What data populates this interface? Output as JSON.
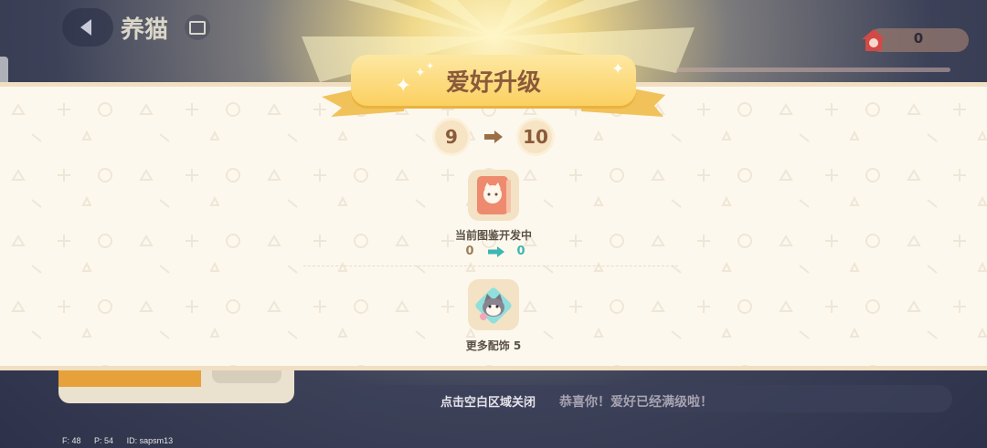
{
  "header": {
    "title": "养猫"
  },
  "currency": {
    "value": "0"
  },
  "modal": {
    "title": "爱好升级",
    "level_from": "9",
    "level_to": "10",
    "rewards": [
      {
        "label": "当前图鉴开发中",
        "from": "0",
        "to": "0"
      },
      {
        "label": "更多配饰 5"
      }
    ]
  },
  "bottom": {
    "close_hint": "点击空白区域关闭",
    "max_level_message": "恭喜你！爱好已经满级啦！"
  },
  "debug": {
    "f": "F: 48",
    "p": "P: 54",
    "id": "ID: sapsm13"
  },
  "colors": {
    "banner": "#fbd061",
    "panel": "#fdf8ee",
    "accent_teal": "#3fb6b0"
  }
}
